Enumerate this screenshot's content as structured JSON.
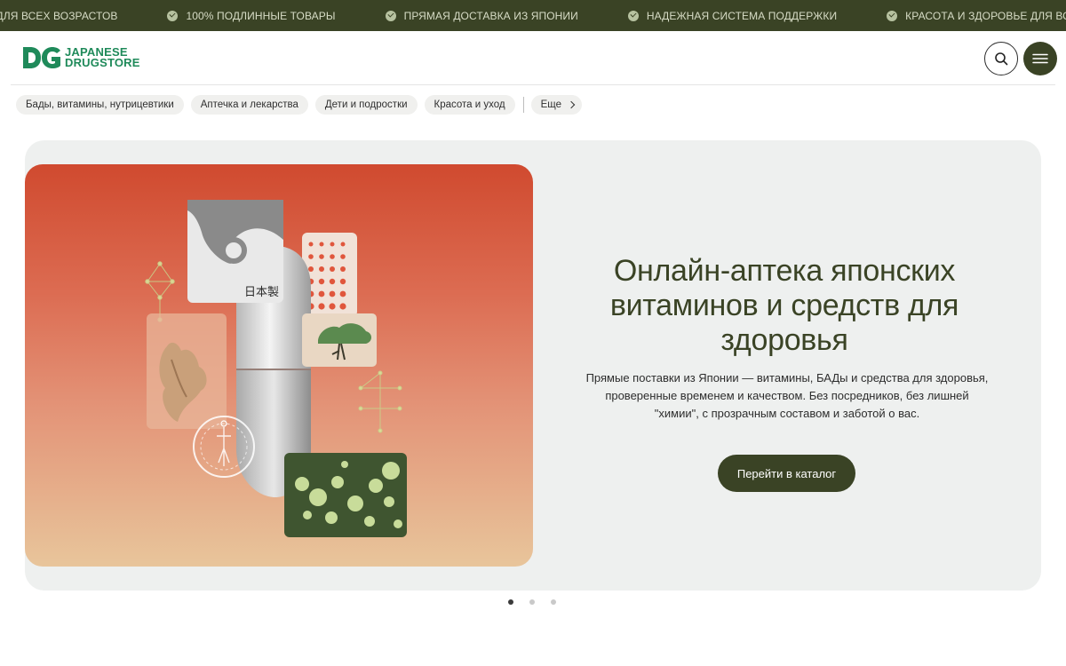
{
  "ticker": {
    "items": [
      "Е ДЛЯ ВСЕХ ВОЗРАСТОВ",
      "100% ПОДЛИННЫЕ ТОВАРЫ",
      "ПРЯМАЯ ДОСТАВКА ИЗ ЯПОНИИ",
      "НАДЕЖНАЯ СИСТЕМА ПОДДЕРЖКИ",
      "КРАСОТА И ЗДОРОВЬЕ ДЛЯ ВСЕХ ВОЗРАСТОВ"
    ]
  },
  "header": {
    "logo": {
      "mark": "DG",
      "line1": "JAPANESE",
      "line2": "DRUGSTORE"
    },
    "search_icon": "search-icon",
    "menu_icon": "hamburger-icon"
  },
  "categories": {
    "items": [
      "Бады, витамины, нутрицевтики",
      "Аптечка и лекарства",
      "Дети и подростки",
      "Красота и уход"
    ],
    "more_label": "Еще"
  },
  "hero": {
    "art_label": "日本製",
    "title": "Онлайн-аптека японских витаминов и средств для здоровья",
    "description": "Прямые поставки из Японии — витамины, БАДы и средства для здоровья, проверенные временем и качеством. Без посредников, без лишней \"химии\", с прозрачным составом и заботой о вас.",
    "cta_label": "Перейти в каталог"
  },
  "carousel": {
    "slides": 3,
    "active": 1
  },
  "colors": {
    "brand_dark": "#3a4325",
    "logo_green": "#1f8a5a",
    "hero_bg": "#eef0ef"
  }
}
